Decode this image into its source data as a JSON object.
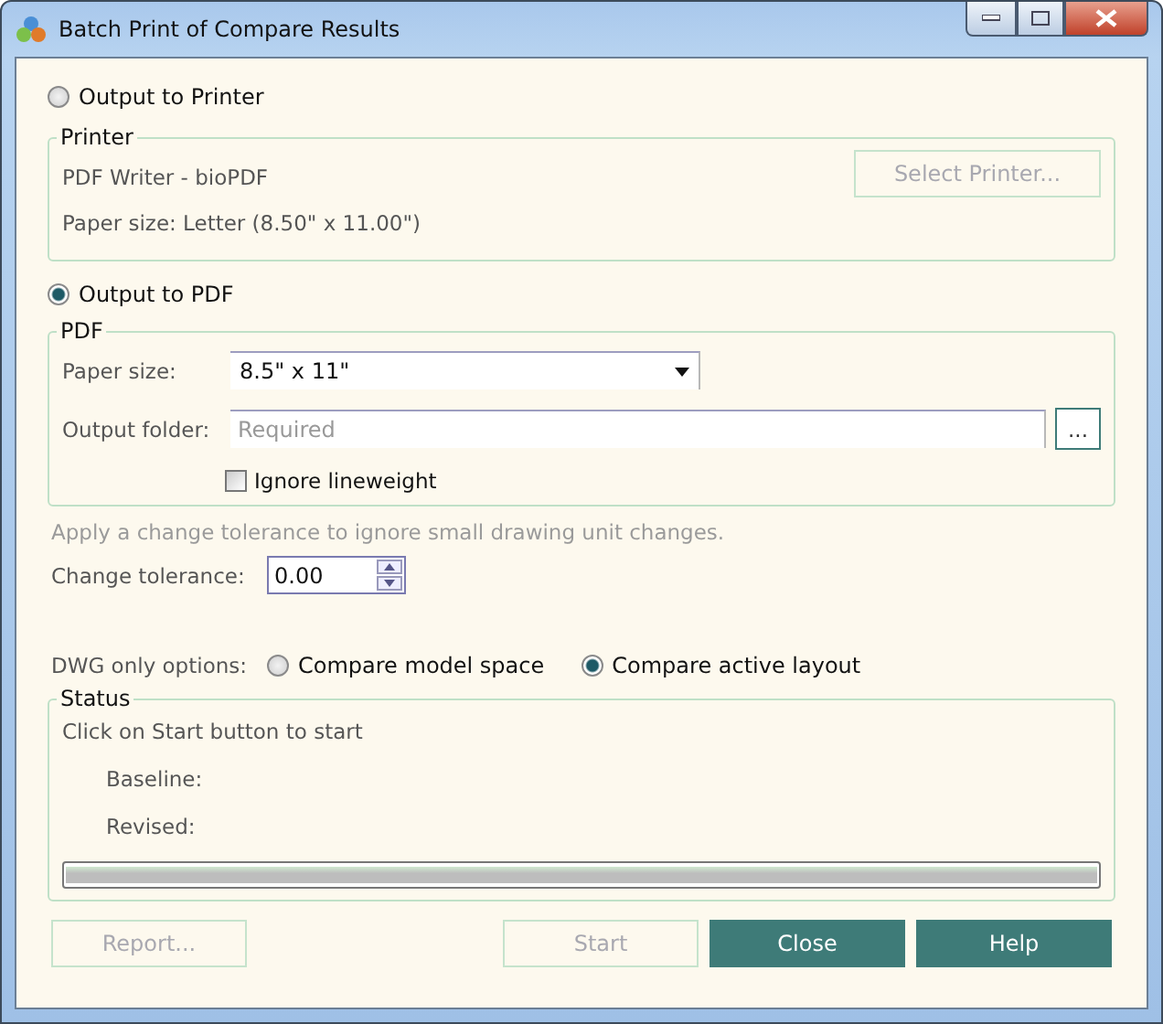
{
  "window": {
    "title": "Batch Print of Compare Results"
  },
  "printer_section": {
    "option": {
      "label": "Output to Printer",
      "selected": false
    },
    "group_title": "Printer",
    "printer": "PDF Writer - bioPDF",
    "paper_size": "Paper size: Letter (8.50\" x 11.00\")",
    "select_button": {
      "label": "Select Printer...",
      "disabled": true
    }
  },
  "pdf_section": {
    "option": {
      "label": "Output to PDF",
      "selected": true
    },
    "group_title": "PDF",
    "paper_size": {
      "label": "Paper size:",
      "value": "8.5\" x 11\""
    },
    "output_folder": {
      "label": "Output folder:",
      "placeholder": "Required",
      "browse": "..."
    },
    "ignore_lineweight": {
      "label": "Ignore lineweight",
      "checked": false
    }
  },
  "tolerance": {
    "hint": "Apply a change tolerance to ignore small drawing unit changes.",
    "label": "Change tolerance:",
    "value": "0.00"
  },
  "dwg_options": {
    "label": "DWG only options:",
    "options": [
      {
        "label": "Compare model space",
        "selected": false
      },
      {
        "label": "Compare active layout",
        "selected": true
      }
    ]
  },
  "status": {
    "group_title": "Status",
    "message": "Click on Start button to start",
    "baseline": "Baseline:",
    "revised": "Revised:",
    "progress": {
      "level": 1
    }
  },
  "buttons": [
    {
      "label": "Report...",
      "disabled": true
    },
    {
      "label": "Start",
      "disabled": true
    },
    {
      "label": "Close",
      "disabled": false
    },
    {
      "label": "Help",
      "disabled": false
    }
  ]
}
